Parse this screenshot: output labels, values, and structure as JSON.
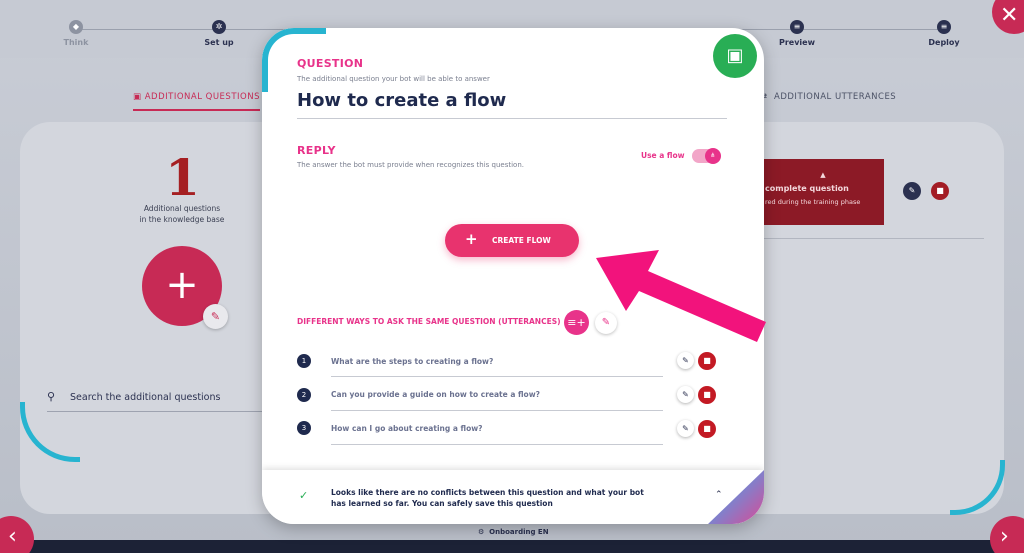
{
  "stepper": {
    "steps": [
      {
        "label": "Think",
        "icon": "shield-icon"
      },
      {
        "label": "Set up",
        "icon": "gear-icon"
      },
      {
        "label": "",
        "icon": "dot-icon"
      },
      {
        "label": "",
        "icon": "dot-icon"
      },
      {
        "label": "",
        "icon": "dot-icon"
      },
      {
        "label": "Preview",
        "icon": "preview-icon"
      },
      {
        "label": "Deploy",
        "icon": "deploy-icon"
      }
    ]
  },
  "tabs": {
    "additional_questions": "ADDITIONAL QUESTIONS",
    "additional_utterances": "ADDITIONAL UTTERANCES"
  },
  "left_panel": {
    "count": "1",
    "count_label_line1": "Additional questions",
    "count_label_line2": "in the knowledge base",
    "search_placeholder": "Search the additional questions"
  },
  "incomplete_card": {
    "title": "complete question",
    "subtitle": "red during the training phase"
  },
  "modal": {
    "question_heading": "QUESTION",
    "question_subheading": "The additional question your bot will be able to answer",
    "question_text": "How to create a flow",
    "reply_heading": "REPLY",
    "reply_subheading": "The answer the bot must provide when recognizes this question.",
    "use_flow_label": "Use a flow",
    "use_flow_enabled": true,
    "create_flow_label": "CREATE FLOW",
    "utterances_heading": "DIFFERENT WAYS TO ASK THE SAME QUESTION (UTTERANCES)",
    "utterances": [
      {
        "num": "1",
        "text": "What are the steps to creating a flow?"
      },
      {
        "num": "2",
        "text": "Can you provide a guide on how to create a flow?"
      },
      {
        "num": "3",
        "text": "How can I go about creating a flow?"
      }
    ],
    "notice_text": "Looks like there are no conflicts between this question and what your bot has learned so far. You can safely save this question"
  },
  "footer": {
    "onboarding_label": "Onboarding EN"
  },
  "colors": {
    "accent_pink": "#e8338a",
    "brand_red": "#c72a55",
    "navy": "#1f2a4e",
    "save_green": "#29ae55",
    "arc_cyan": "#27b4d0"
  }
}
